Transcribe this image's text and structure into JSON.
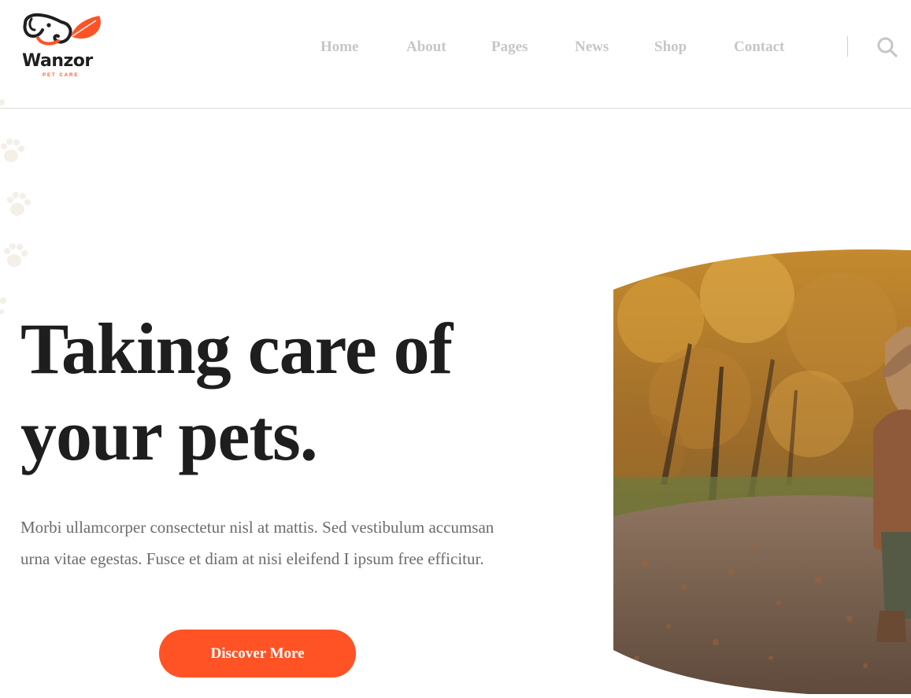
{
  "brand": {
    "name": "Wanzor",
    "tagline": "PET CARE",
    "accent": "#ff5325",
    "text_color": "#1e1e1e",
    "logo_icon": "elephant-with-leaf-logo"
  },
  "nav": {
    "items": [
      {
        "label": "Home"
      },
      {
        "label": "About"
      },
      {
        "label": "Pages"
      },
      {
        "label": "News"
      },
      {
        "label": "Shop"
      },
      {
        "label": "Contact"
      }
    ],
    "search_icon": "search-icon",
    "color": "#c6c6c6"
  },
  "hero": {
    "headline_line1": "Taking care of",
    "headline_line2": "your pets.",
    "description": "Morbi ullamcorper consectetur nisl at mattis. Sed vestibulum accumsan urna vitae egestas. Fusce et diam at nisi eleifend I ipsum free efficitur.",
    "cta_label": "Discover More",
    "image": "woman-with-dog-in-autumn-forest-photo",
    "decoration": "paw-prints-pattern"
  }
}
